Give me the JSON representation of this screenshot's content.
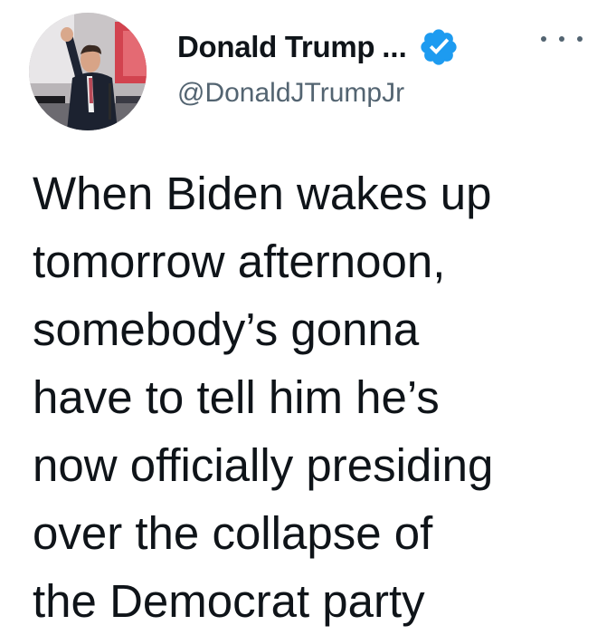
{
  "author": {
    "display_name": "Donald Trump",
    "truncation": "...",
    "handle": "@DonaldJTrumpJr",
    "verified": true,
    "avatar_icon": "profile-photo"
  },
  "icons": {
    "verified_badge": "verified-checkmark-icon",
    "more": "more-options-icon"
  },
  "colors": {
    "verified_blue": "#1d9bf0",
    "text": "#0f1419",
    "secondary_text": "#536471"
  },
  "tweet": {
    "lines": [
      "When Biden wakes up",
      "tomorrow afternoon,",
      "somebody’s gonna",
      "have to tell him he’s",
      "now officially presiding",
      "over the collapse of",
      "the Democrat party"
    ]
  }
}
